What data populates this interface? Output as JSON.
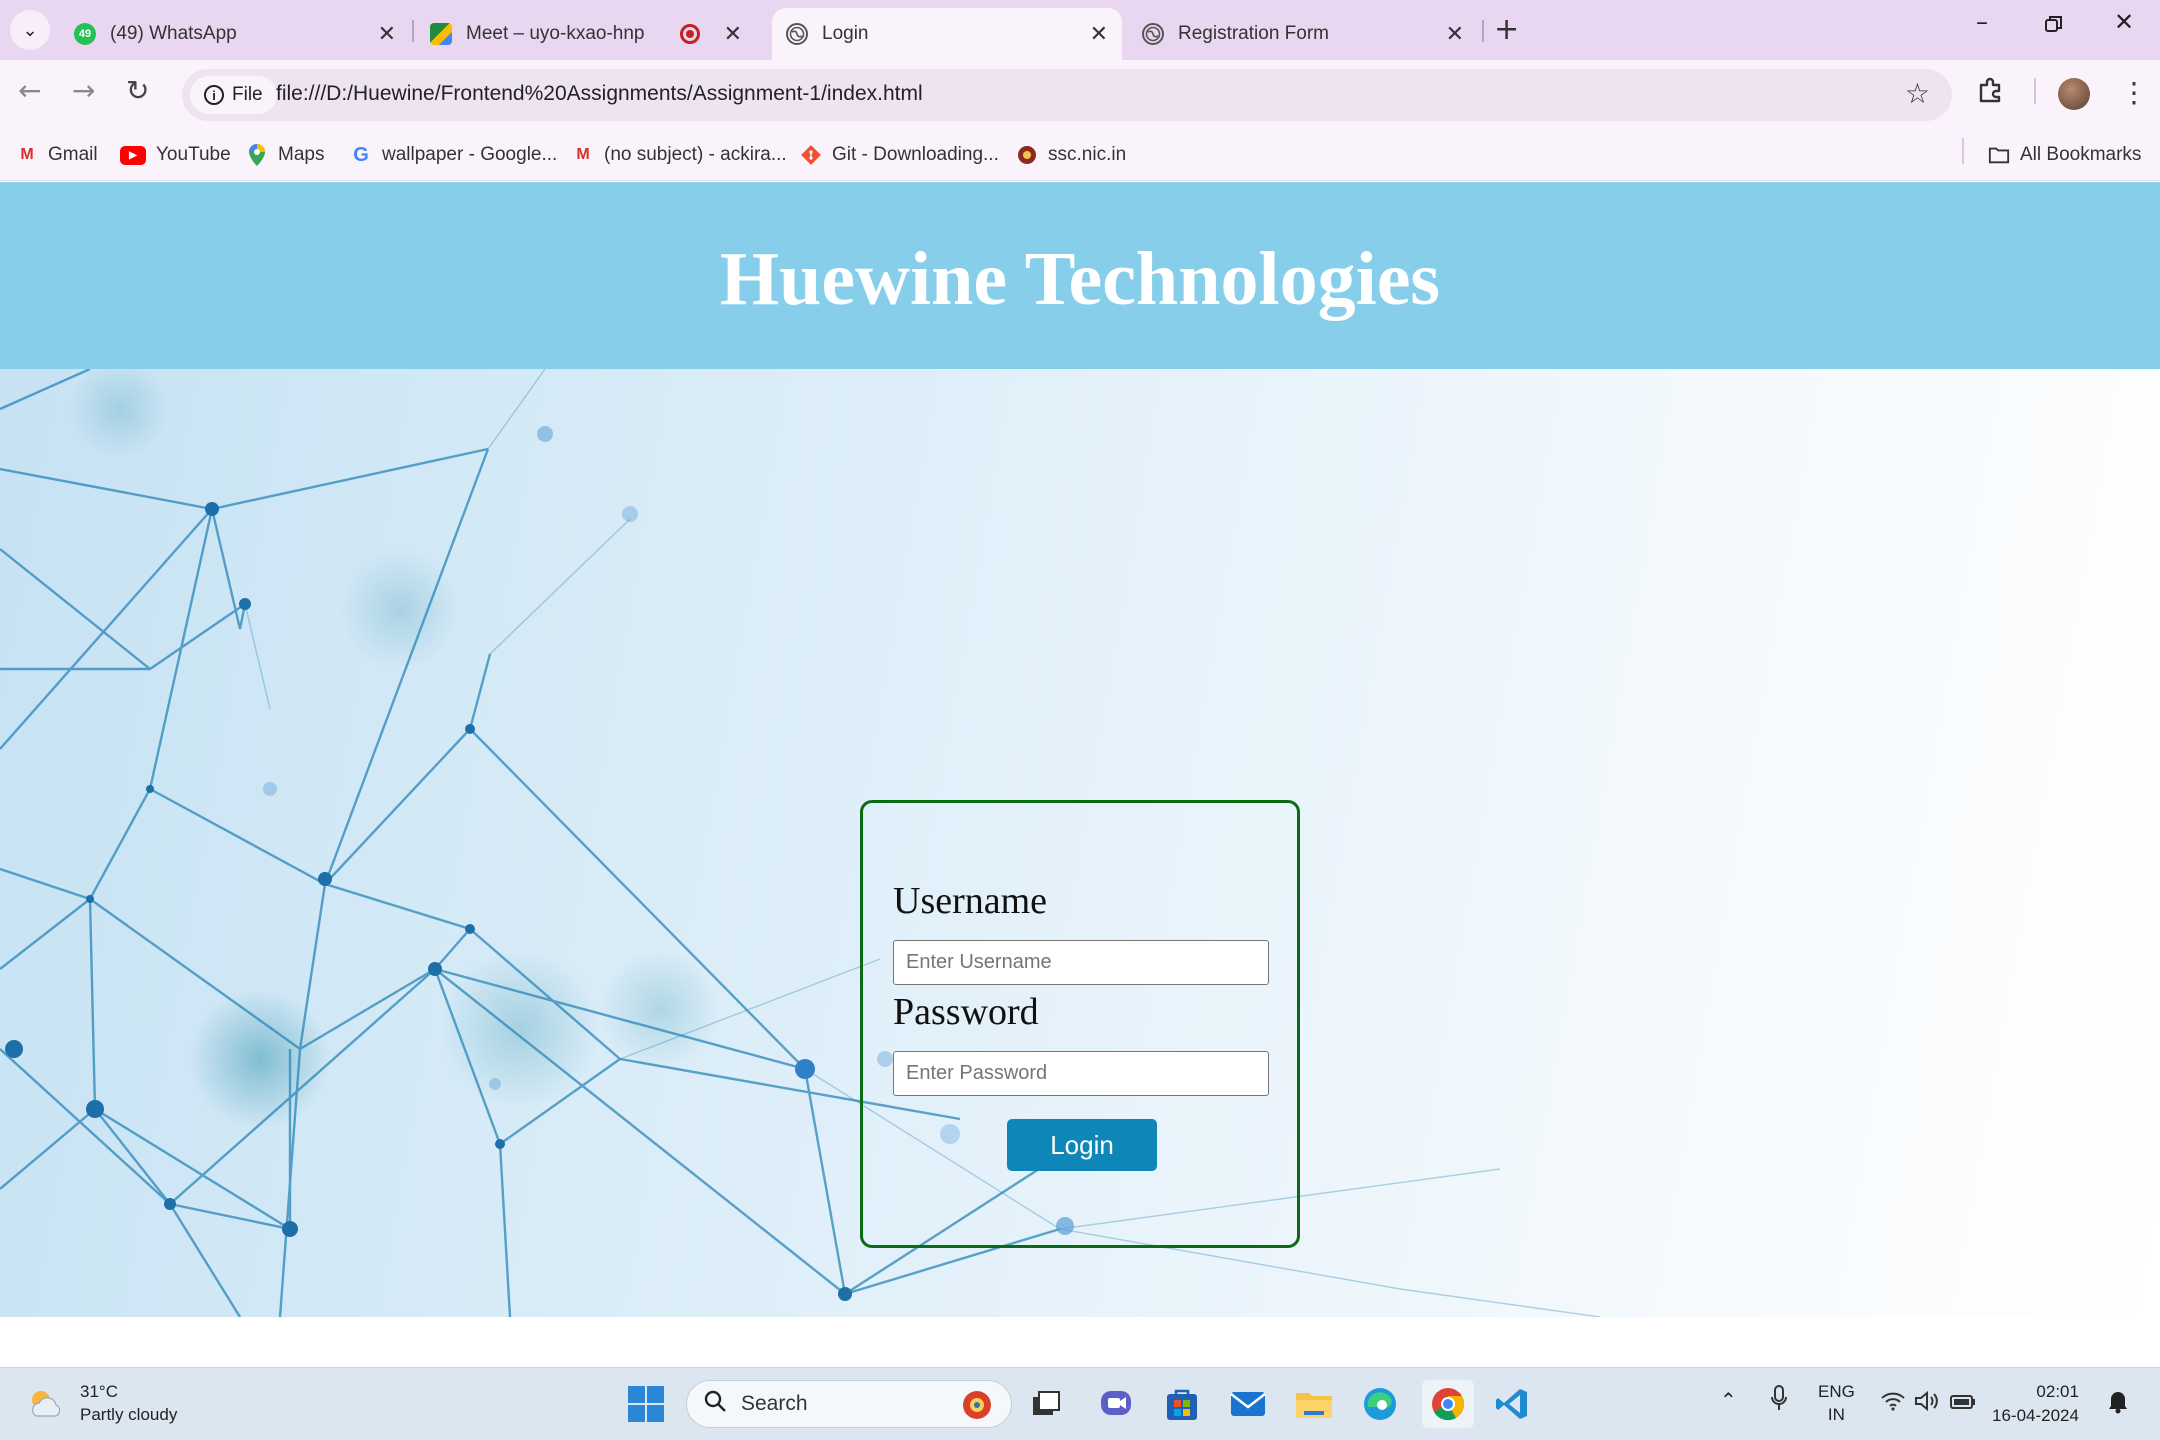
{
  "browser": {
    "tabs": [
      {
        "title": "(49) WhatsApp",
        "badge": "49",
        "favicon": "whatsapp-icon",
        "active": false
      },
      {
        "title": "Meet – uyo-kxao-hnp",
        "favicon": "google-meet-icon",
        "active": false
      },
      {
        "title": "Login",
        "favicon": "globe-icon",
        "active": true
      },
      {
        "title": "Registration Form",
        "favicon": "globe-icon",
        "active": false
      }
    ],
    "site_chip_label": "File",
    "url": "file:///D:/Huewine/Frontend%20Assignments/Assignment-1/index.html",
    "bookmarks": [
      {
        "label": "Gmail",
        "icon": "gmail-icon"
      },
      {
        "label": "YouTube",
        "icon": "youtube-icon"
      },
      {
        "label": "Maps",
        "icon": "maps-icon"
      },
      {
        "label": "wallpaper - Google...",
        "icon": "google-icon"
      },
      {
        "label": "(no subject) - ackira...",
        "icon": "gmail-icon"
      },
      {
        "label": "Git - Downloading...",
        "icon": "git-icon"
      },
      {
        "label": "ssc.nic.in",
        "icon": "emblem-icon"
      }
    ],
    "all_bookmarks_label": "All Bookmarks"
  },
  "page": {
    "header_title": "Huewine Technologies",
    "login": {
      "username_label": "Username",
      "username_placeholder": "Enter Username",
      "password_label": "Password",
      "password_placeholder": "Enter Password",
      "button_label": "Login"
    },
    "colors": {
      "header_bg": "#87ceeb",
      "box_border": "#0a6b12",
      "button_bg": "#0e86b8"
    }
  },
  "taskbar": {
    "weather_temp": "31°C",
    "weather_desc": "Partly cloudy",
    "search_label": "Search",
    "lang_top": "ENG",
    "lang_bottom": "IN",
    "time": "02:01",
    "date": "16-04-2024"
  }
}
